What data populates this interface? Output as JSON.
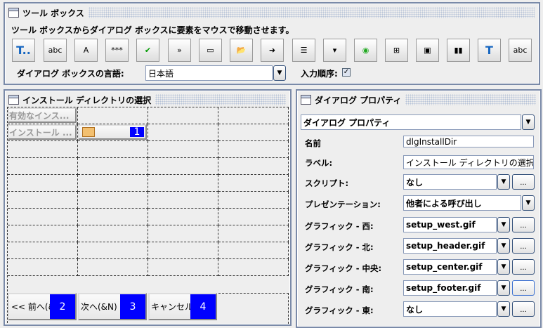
{
  "toolbox": {
    "title": "ツール ボックス",
    "instruction": "ツール ボックスからダイアログ ボックスに要素をマウスで移動させます。",
    "tools": [
      "text-tool-icon",
      "label-icon",
      "textbox-icon",
      "password-icon",
      "checkbox-icon",
      "disabled-button-icon",
      "button-icon",
      "folder-browse-icon",
      "file-browse-icon",
      "listbox-icon",
      "combobox-icon",
      "radio-icon",
      "tree-icon",
      "image-icon",
      "progress-icon",
      "text-link-icon",
      "label-progress-icon"
    ],
    "language_label": "ダイアログ ボックスの言語:",
    "language_value": "日本語",
    "tab_order_label": "入力順序:",
    "tab_order_checked": true
  },
  "dialog": {
    "title": "インストール ディレクトリの選択",
    "controls": [
      {
        "text": "有効なインス..."
      },
      {
        "text": "インストール ..."
      }
    ],
    "browse_badge": "1",
    "buttons": [
      {
        "text": "<< 前へ(&B)",
        "badge": "2"
      },
      {
        "text": "次へ(&N)",
        "badge": "3"
      },
      {
        "text": "キャンセル",
        "badge": "4"
      }
    ]
  },
  "properties": {
    "title": "ダイアログ プロパティ",
    "selector": "ダイアログ プロパティ",
    "rows": [
      {
        "label": "名前",
        "value": "dlgInstallDir"
      },
      {
        "label": "ラベル:",
        "value": "インストール ディレクトリの選択"
      },
      {
        "label": "スクリプト:",
        "value": "なし"
      },
      {
        "label": "プレゼンテーション:",
        "value": "他者による呼び出し"
      },
      {
        "label": "グラフィック - 西:",
        "value": "setup_west.gif"
      },
      {
        "label": "グラフィック - 北:",
        "value": "setup_header.gif"
      },
      {
        "label": "グラフィック - 中央:",
        "value": "setup_center.gif"
      },
      {
        "label": "グラフィック - 南:",
        "value": "setup_footer.gif"
      },
      {
        "label": "グラフィック - 東:",
        "value": "なし"
      }
    ],
    "more_label": "..."
  }
}
